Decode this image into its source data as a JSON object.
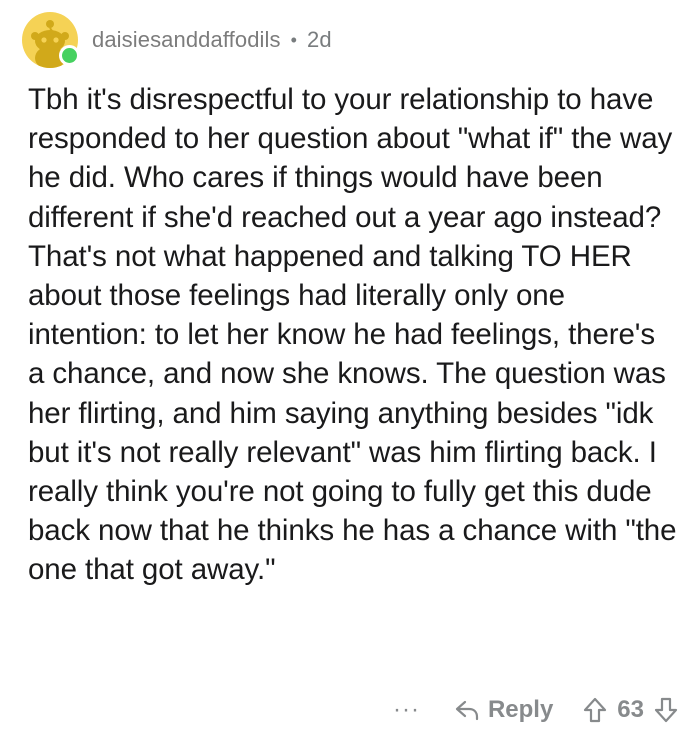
{
  "comment": {
    "username": "daisiesanddaffodils",
    "separator": "•",
    "age": "2d",
    "body": "Tbh it's disrespectful to your relationship to have responded to her question about \"what if\" the way he did. Who cares if things would have been different if she'd reached out a year ago instead? That's not what happened and talking TO HER about those feelings had literally only one intention: to let her know he had feelings, there's a chance, and now she knows. The question was her flirting, and him saying anything besides \"idk but it's not really relevant\" was him flirting back. I really think you're not going to fully get this dude back now that he thinks he has a chance with \"the one that got away.\"",
    "actions": {
      "more": "···",
      "reply_label": "Reply",
      "score": "63"
    }
  },
  "colors": {
    "avatar_bg": "#f5d255",
    "online": "#46d160",
    "meta_text": "#787c7e",
    "body_text": "#1a1a1b",
    "action_text": "#878a8c"
  },
  "icons": {
    "avatar": "snoo-avatar-icon",
    "reply": "reply-arrow-icon",
    "upvote": "upvote-arrow-icon",
    "downvote": "downvote-arrow-icon"
  }
}
